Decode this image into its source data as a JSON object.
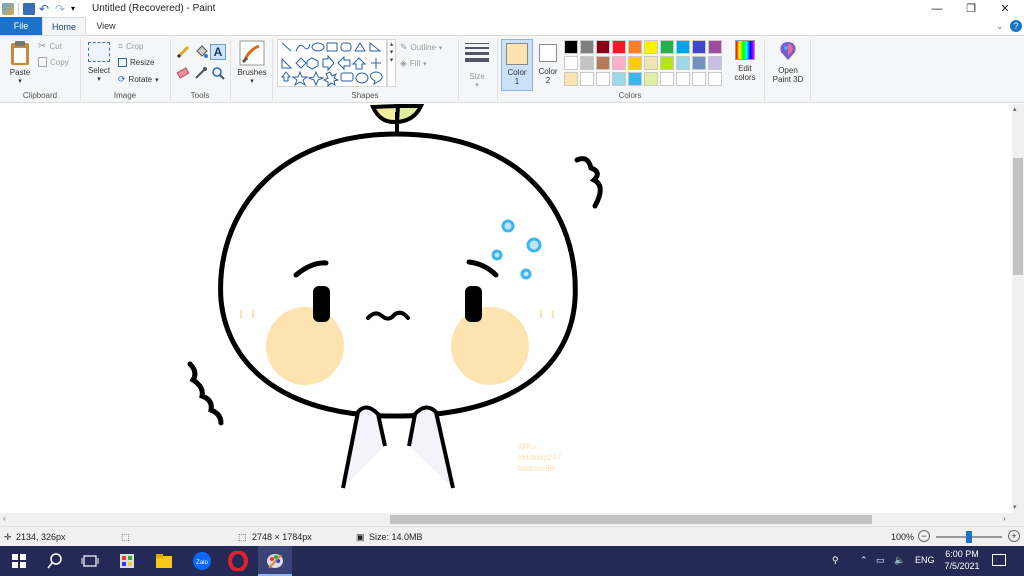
{
  "window": {
    "title": "Untitled (Recovered) - Paint"
  },
  "tabs": [
    "File",
    "Home",
    "View"
  ],
  "ribbon": {
    "clipboard": {
      "paste": "Paste",
      "cut": "Cut",
      "copy": "Copy",
      "group": "Clipboard"
    },
    "image": {
      "select": "Select",
      "crop": "Crop",
      "resize": "Resize",
      "rotate": "Rotate",
      "group": "Image"
    },
    "tools": {
      "group": "Tools"
    },
    "brushes": {
      "label": "Brushes"
    },
    "shapes": {
      "outline": "Outline",
      "fill": "Fill",
      "group": "Shapes"
    },
    "size": {
      "label": "Size"
    },
    "color1": {
      "label": "Color",
      "num": "1",
      "value": "#fde3b0"
    },
    "color2": {
      "label": "Color",
      "num": "2",
      "value": "#ffffff"
    },
    "colors": {
      "group": "Colors",
      "edit_label": "Edit",
      "edit_label2": "colors",
      "palette_row1": [
        "#000000",
        "#7f7f7f",
        "#880015",
        "#ed1c24",
        "#ff7f27",
        "#fff200",
        "#22b14c",
        "#00a2e8",
        "#3f48cc",
        "#a349a4"
      ],
      "palette_row2": [
        "#ffffff",
        "#c3c3c3",
        "#b97a57",
        "#ffaec9",
        "#ffc90e",
        "#efe4b0",
        "#b5e61d",
        "#99d9ea",
        "#7092be",
        "#c8bfe7"
      ],
      "palette_row3": [
        "#fde3b0",
        "#ffffff",
        "#ffffff",
        "#99d9ea",
        "#3db6f0",
        "#e0f0a0",
        "#ffffff",
        "#ffffff",
        "#ffffff",
        "#ffffff"
      ]
    },
    "paint3d": {
      "label": "Open",
      "label2": "Paint 3D"
    }
  },
  "canvas": {
    "watermark": [
      "@Ku",
      "#Holdap247",
      "Nalione96"
    ]
  },
  "status": {
    "cursor": "2134, 326px",
    "dimensions": "2748 × 1784px",
    "size": "Size: 14.0MB",
    "zoom": "100%"
  },
  "taskbar": {
    "lang": "ENG",
    "time": "6:00 PM",
    "date": "7/5/2021"
  }
}
